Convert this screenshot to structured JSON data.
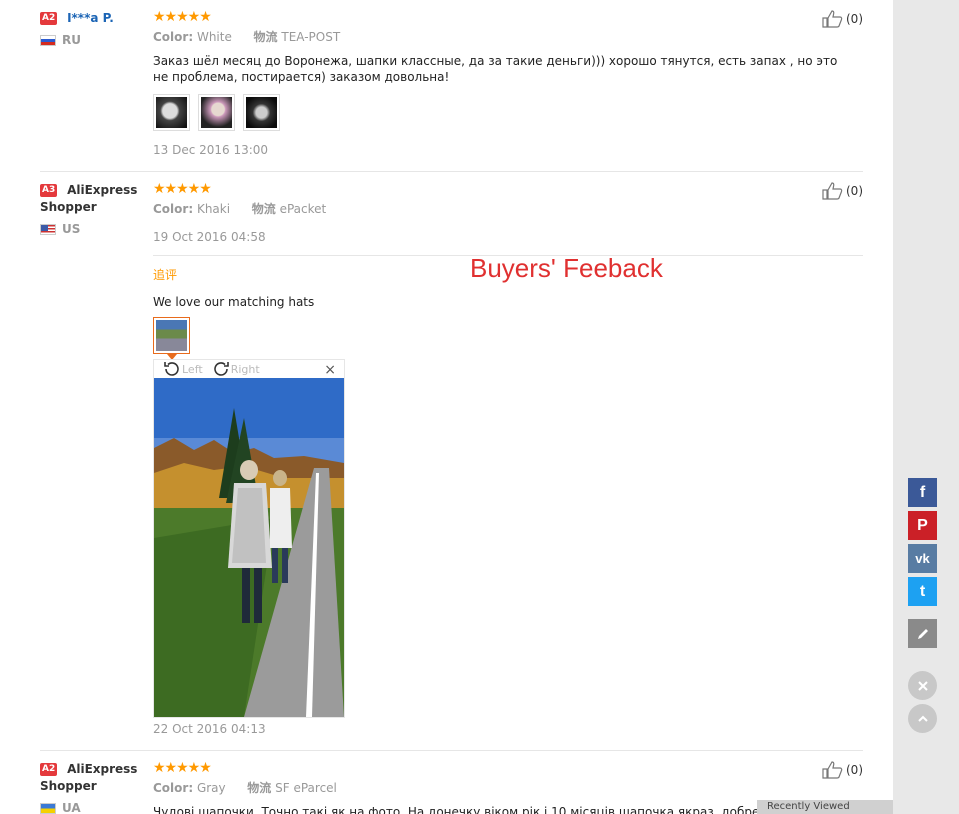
{
  "reviews": [
    {
      "level": "A2",
      "name": "I***a P.",
      "country": "RU",
      "stars": "★★★★★",
      "color_label": "Color:",
      "color_value": "White",
      "shipping_label": "物流",
      "shipping_value": "TEA-POST",
      "text": "Заказ шёл месяц до Воронежа, шапки классные, да за такие деньги))) хорошо тянутся, есть запах , но это не проблема, постирается) заказом довольна!",
      "date": "13 Dec 2016 13:00",
      "likes": "(0)"
    },
    {
      "level": "A3",
      "name": "AliExpress Shopper",
      "country": "US",
      "stars": "★★★★★",
      "color_label": "Color:",
      "color_value": "Khaki",
      "shipping_label": "物流",
      "shipping_value": "ePacket",
      "date": "19 Oct 2016 04:58",
      "likes": "(0)",
      "additional": {
        "label": "追评",
        "text": "We love our matching hats",
        "rotate_left": "Left",
        "rotate_right": "Right",
        "close": "×",
        "date": "22 Oct 2016 04:13"
      }
    },
    {
      "level": "A2",
      "name": "AliExpress Shopper",
      "country": "UA",
      "stars": "★★★★★",
      "color_label": "Color:",
      "color_value": "Gray",
      "shipping_label": "物流",
      "shipping_value": "SF eParcel",
      "text": "Чудові шапочки. Точно такі як на фото. На донечку віком рік і 10 місяців шапочка якраз, добре було якби т",
      "likes": "(0)"
    }
  ],
  "annotation": "Buyers' Feeback",
  "share": {
    "facebook": "f",
    "pinterest": "P",
    "vk": "vk",
    "twitter": "t"
  },
  "popup_text": "Recently Viewed"
}
